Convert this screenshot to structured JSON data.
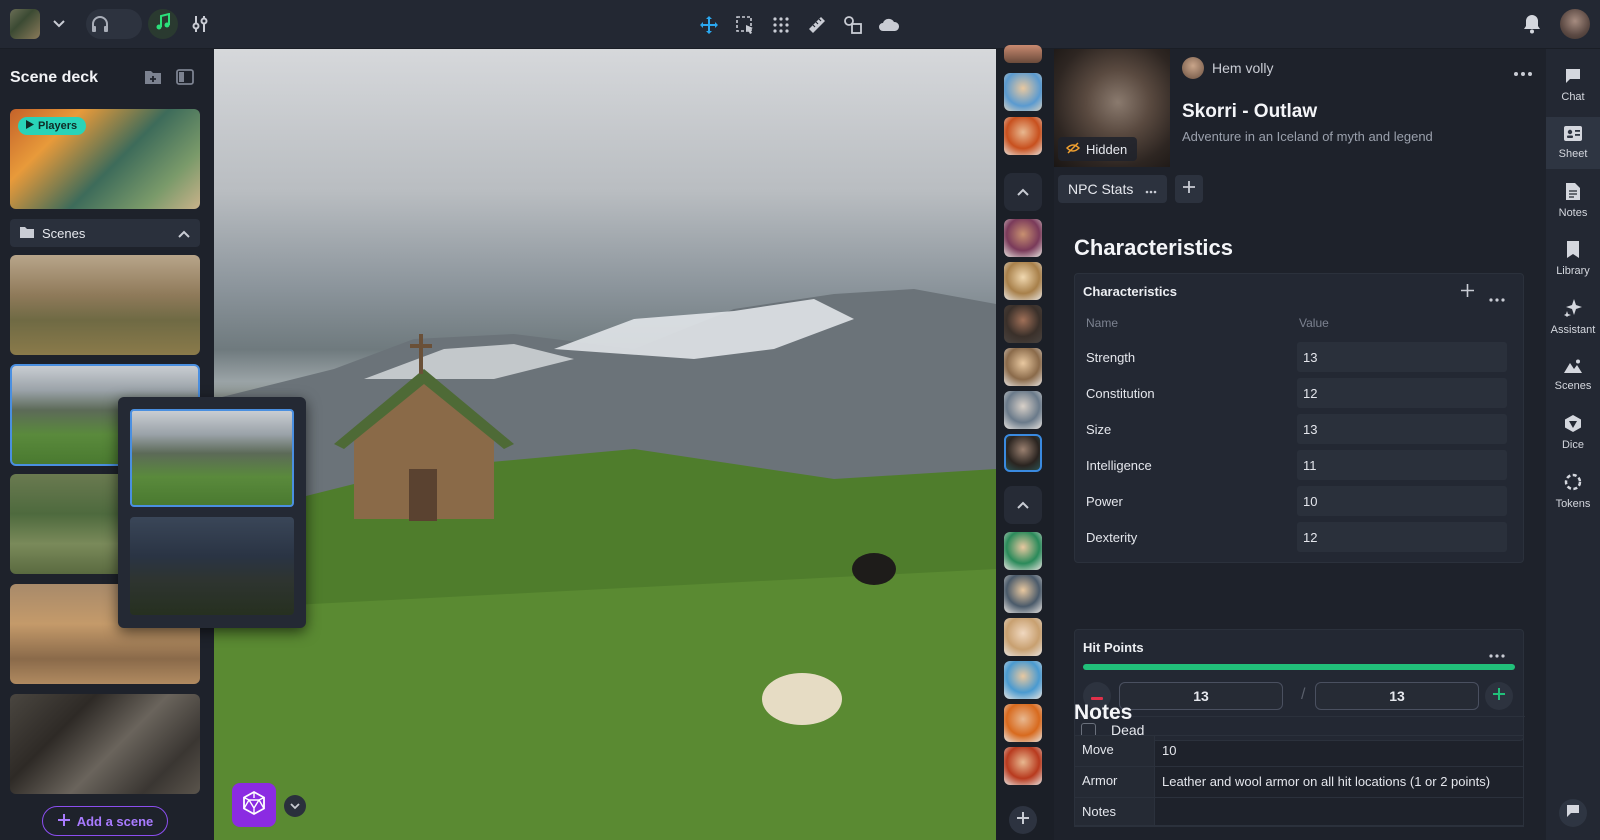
{
  "topbar": {
    "game_icon": "game-thumbnail",
    "audio_icon": "headphones-icon",
    "music_icon": "music-note-icon",
    "mixer_icon": "sliders-icon",
    "tools": [
      "move-icon",
      "select-icon",
      "grid-icon",
      "ruler-icon",
      "shapes-icon",
      "fog-icon"
    ],
    "notifications_icon": "bell-icon",
    "accent_color": "#29d3b8"
  },
  "deck": {
    "title": "Scene deck",
    "players_badge": "Players",
    "scenes_label": "Scenes",
    "add_scene_label": "Add a scene"
  },
  "sheet": {
    "owner": "Hem volly",
    "name": "Skorri - Outlaw",
    "tagline": "Adventure in an Iceland of myth and legend",
    "hidden_label": "Hidden",
    "tab_label": "NPC Stats",
    "characteristics_heading": "Characteristics",
    "characteristics_box_title": "Characteristics",
    "col_name": "Name",
    "col_value": "Value",
    "stats": [
      {
        "name": "Strength",
        "value": "13"
      },
      {
        "name": "Constitution",
        "value": "12"
      },
      {
        "name": "Size",
        "value": "13"
      },
      {
        "name": "Intelligence",
        "value": "11"
      },
      {
        "name": "Power",
        "value": "10"
      },
      {
        "name": "Dexterity",
        "value": "12"
      }
    ],
    "hp_title": "Hit Points",
    "hp_current": "13",
    "hp_max": "13",
    "hp_fraction": 1.0,
    "hp_sep": "/",
    "dead_label": "Dead",
    "notes_heading": "Notes",
    "notes": [
      {
        "key": "Move",
        "value": "10"
      },
      {
        "key": "Armor",
        "value": "Leather and wool armor on all hit locations (1 or 2 points)"
      },
      {
        "key": "Notes",
        "value": ""
      }
    ]
  },
  "rnav": {
    "items": [
      {
        "label": "Chat",
        "icon": "chat-icon"
      },
      {
        "label": "Sheet",
        "icon": "sheet-icon"
      },
      {
        "label": "Notes",
        "icon": "notes-icon"
      },
      {
        "label": "Library",
        "icon": "library-icon"
      },
      {
        "label": "Assistant",
        "icon": "sparkle-icon"
      },
      {
        "label": "Scenes",
        "icon": "scenes-icon"
      },
      {
        "label": "Dice",
        "icon": "dice-icon"
      },
      {
        "label": "Tokens",
        "icon": "tokens-icon"
      }
    ],
    "active": "Sheet"
  }
}
